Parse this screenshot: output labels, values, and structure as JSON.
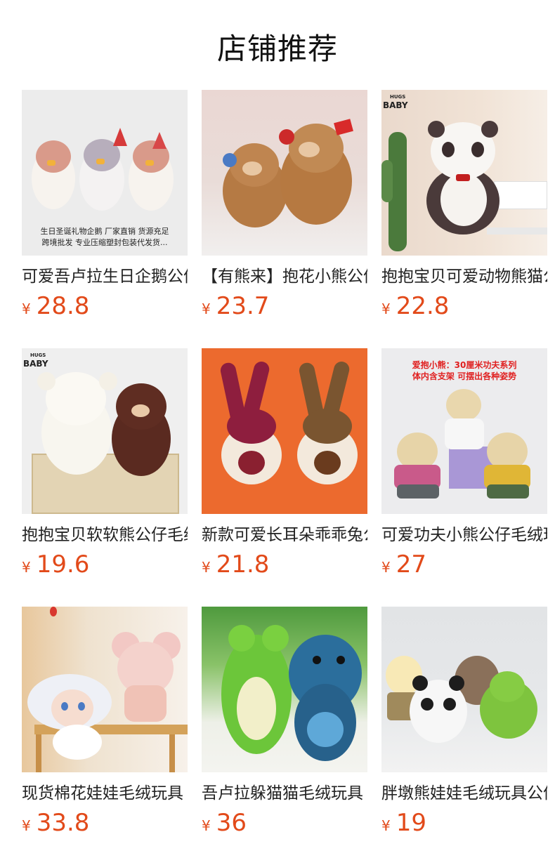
{
  "section_title": "店铺推荐",
  "currency_symbol": "¥",
  "products": [
    {
      "name": "可爱吾卢拉生日企鹅公仔",
      "price": "28.8",
      "image": "penguin-plush-trio",
      "caption_line1": "生日圣诞礼物企鹅 厂家直销 货源充足",
      "caption_line2": "跨境批发 专业压缩塑封包装代发货..."
    },
    {
      "name": "【有熊来】抱花小熊公仔",
      "price": "23.7",
      "image": "brown-bears-with-roses"
    },
    {
      "name": "抱抱宝贝可爱动物熊猫公仔",
      "price": "22.8",
      "image": "panda-plush",
      "brand": "BABY",
      "brand_small": "HUGS"
    },
    {
      "name": "抱抱宝贝软软熊公仔毛绒",
      "price": "19.6",
      "image": "white-and-brown-bears-basket",
      "brand": "BABY",
      "brand_small": "HUGS"
    },
    {
      "name": "新款可爱长耳朵乖乖兔公仔",
      "price": "21.8",
      "image": "long-ear-bunnies-orange"
    },
    {
      "name": "可爱功夫小熊公仔毛绒玩具",
      "price": "27",
      "image": "kungfu-bears",
      "red_line1": "爱抱小熊：30厘米功夫系列",
      "red_line2": "体内含支架 可摆出各种姿势"
    },
    {
      "name": "现货棉花娃娃毛绒玩具",
      "price": "33.8",
      "image": "cotton-dolls"
    },
    {
      "name": "吾卢拉躲猫猫毛绒玩具",
      "price": "36",
      "image": "frog-and-dino-plush"
    },
    {
      "name": "胖墩熊娃娃毛绒玩具公仔",
      "price": "19",
      "image": "chubby-plush-group"
    }
  ]
}
